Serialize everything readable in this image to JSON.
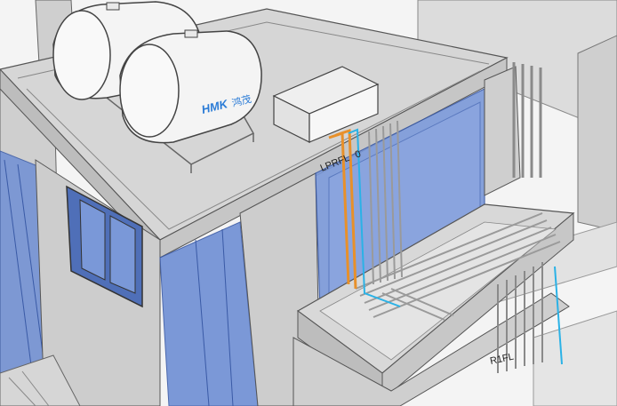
{
  "diagram": {
    "tank_brand": "HMK",
    "tank_brand_cjk": "鸿茂",
    "label_roof_level": "LPRFL",
    "label_roof_level_suffix": "0",
    "label_floor_level": "R1FL"
  },
  "colors": {
    "concrete": "#d6d6d6",
    "concrete_dark": "#bdbdbd",
    "glass": "#7a98d8",
    "glass_dark": "#4f6fb8",
    "pipe_orange": "#e8902a",
    "pipe_cyan": "#2bb2e6",
    "pipe_grey": "#9a9a9a",
    "tank": "#f4f4f4",
    "brand_blue": "#2a7bd6"
  }
}
